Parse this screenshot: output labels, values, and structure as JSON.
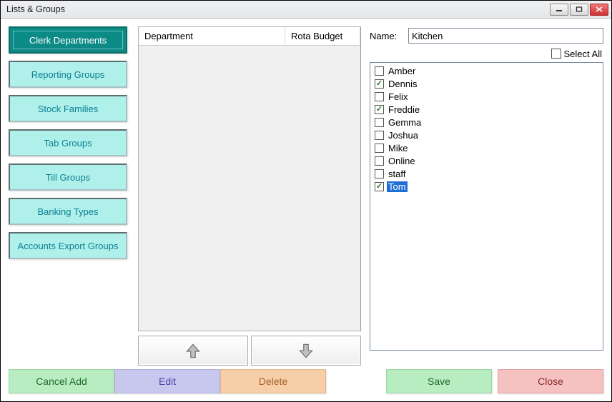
{
  "titlebar": {
    "title": "Lists & Groups"
  },
  "sidebar": {
    "items": [
      {
        "label": "Clerk Departments",
        "active": true
      },
      {
        "label": "Reporting Groups",
        "active": false
      },
      {
        "label": "Stock Families",
        "active": false
      },
      {
        "label": "Tab Groups",
        "active": false
      },
      {
        "label": "Till Groups",
        "active": false
      },
      {
        "label": "Banking Types",
        "active": false
      },
      {
        "label": "Accounts Export Groups",
        "active": false
      }
    ]
  },
  "grid": {
    "columns": [
      "Department",
      "Rota Budget"
    ]
  },
  "name_field": {
    "label": "Name:",
    "value": "Kitchen"
  },
  "select_all": {
    "label": "Select All",
    "checked": false
  },
  "members": [
    {
      "label": "Amber",
      "checked": false,
      "selected": false
    },
    {
      "label": "Dennis",
      "checked": true,
      "selected": false
    },
    {
      "label": "Felix",
      "checked": false,
      "selected": false
    },
    {
      "label": "Freddie",
      "checked": true,
      "selected": false
    },
    {
      "label": "Gemma",
      "checked": false,
      "selected": false
    },
    {
      "label": "Joshua",
      "checked": false,
      "selected": false
    },
    {
      "label": "Mike",
      "checked": false,
      "selected": false
    },
    {
      "label": "Online",
      "checked": false,
      "selected": false
    },
    {
      "label": "staff",
      "checked": false,
      "selected": false
    },
    {
      "label": "Tom",
      "checked": true,
      "selected": true
    }
  ],
  "buttons": {
    "cancel": "Cancel Add",
    "edit": "Edit",
    "delete": "Delete",
    "save": "Save",
    "close": "Close"
  }
}
